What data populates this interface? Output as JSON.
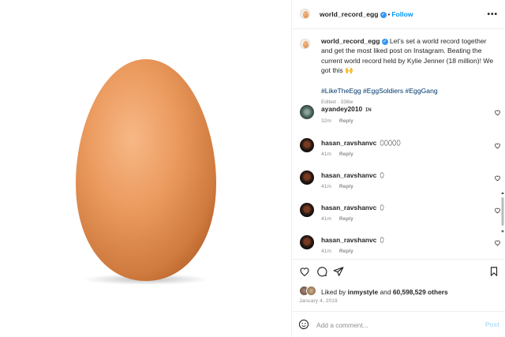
{
  "post": {
    "username": "world_record_egg",
    "follow_label": "Follow",
    "more_label": "•••",
    "caption_text": "Let’s set a world record together and get the most liked post on Instagram. Beating the current world record held by Kylie Jenner (18 million)! We got this 🙌",
    "hashtags": "#LikeTheEgg #EggSoldiers #EggGang",
    "edited": "Edited · 338w"
  },
  "comments": [
    {
      "user": "ayandey2010",
      "text": "ɪɴ",
      "time": "32m",
      "reply": "Reply",
      "avatar": "landscape"
    },
    {
      "user": "hasan_ravshanvc",
      "text": "⬯⬯⬯⬯⬯",
      "time": "41m",
      "reply": "Reply",
      "avatar": "portrait"
    },
    {
      "user": "hasan_ravshanvc",
      "text": "⬯",
      "time": "41m",
      "reply": "Reply",
      "avatar": "portrait"
    },
    {
      "user": "hasan_ravshanvc",
      "text": "⬯",
      "time": "41m",
      "reply": "Reply",
      "avatar": "portrait"
    },
    {
      "user": "hasan_ravshanvc",
      "text": "⬯",
      "time": "41m",
      "reply": "Reply",
      "avatar": "portrait"
    }
  ],
  "actions": {
    "liked_by_prefix": "Liked by ",
    "liked_by_user": "inmystyle",
    "liked_and": " and ",
    "likes_count": "60,598,529 others",
    "date": "January 4, 2019"
  },
  "composer": {
    "placeholder": "Add a comment...",
    "post_label": "Post"
  },
  "colors": {
    "accent": "#0095f6",
    "verified": "#3897f0",
    "muted": "#8e8e8e",
    "egg": "#e8955a"
  }
}
